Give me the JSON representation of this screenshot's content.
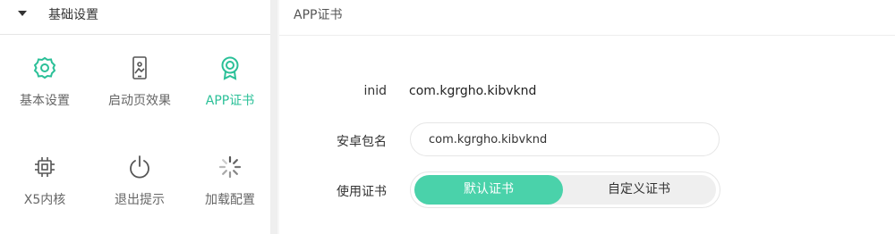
{
  "sidebar": {
    "section_title": "基础设置",
    "items": [
      {
        "label": "基本设置",
        "icon": "gear-icon",
        "active": false
      },
      {
        "label": "启动页效果",
        "icon": "phone-image-icon",
        "active": false
      },
      {
        "label": "APP证书",
        "icon": "certificate-badge-icon",
        "active": true
      },
      {
        "label": "X5内核",
        "icon": "chip-icon",
        "active": false
      },
      {
        "label": "退出提示",
        "icon": "power-icon",
        "active": false
      },
      {
        "label": "加载配置",
        "icon": "loading-spinner-icon",
        "active": false
      }
    ]
  },
  "panel": {
    "title": "APP证书",
    "appid_label": "inid",
    "appid_value": "com.kgrgho.kibvknd",
    "package_label": "安卓包名",
    "package_value": "com.kgrgho.kibvknd",
    "cert_label": "使用证书",
    "cert_options": [
      "默认证书",
      "自定义证书"
    ],
    "cert_selected": "默认证书"
  },
  "colors": {
    "accent": "#2bc098",
    "segment_active": "#4ad2aa",
    "segment_inactive": "#efefef"
  }
}
